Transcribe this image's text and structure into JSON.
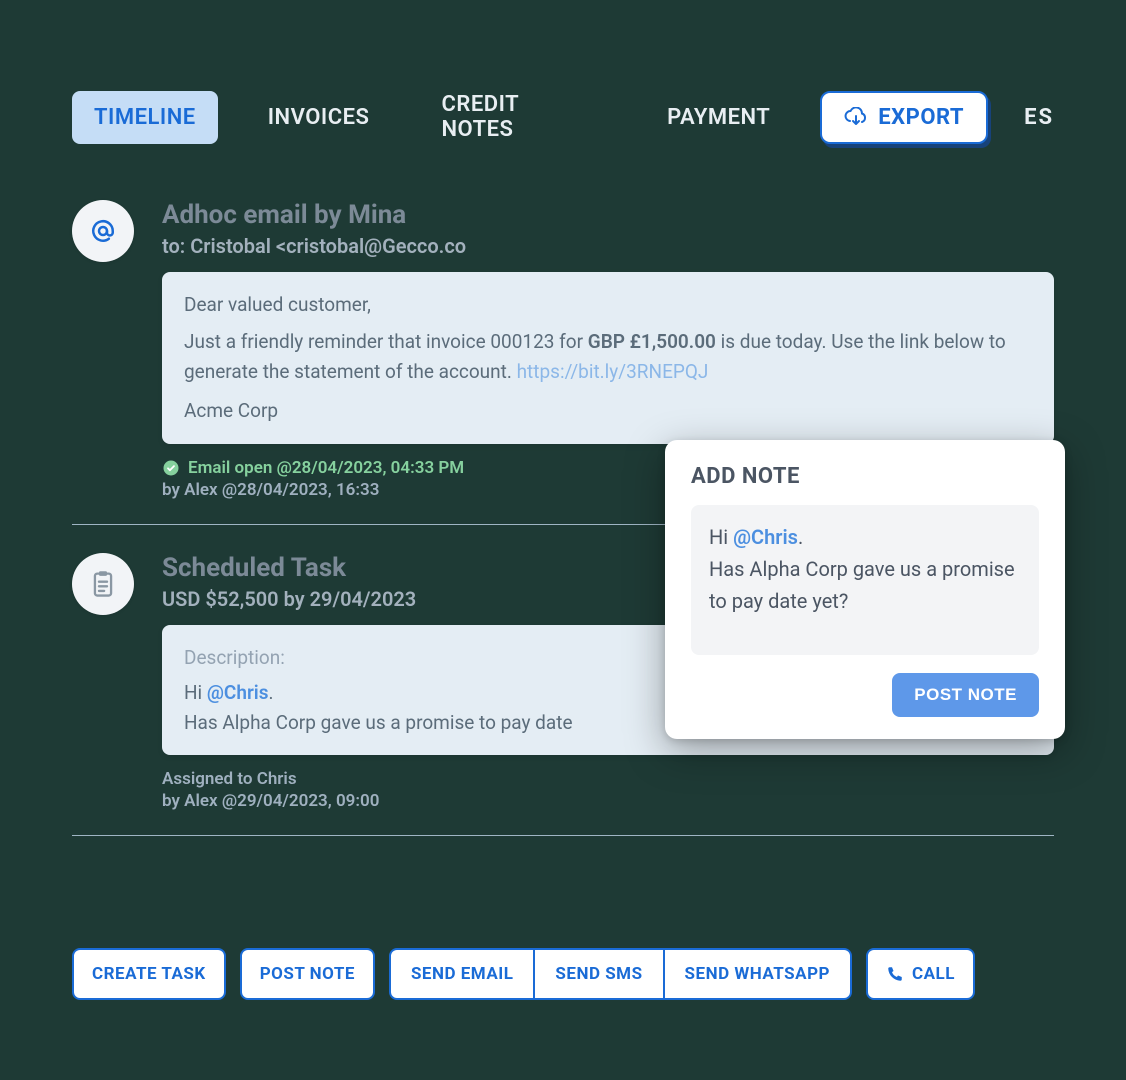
{
  "tabs": {
    "timeline": "TIMELINE",
    "invoices": "INVOICES",
    "credit_notes": "CREDIT NOTES",
    "payment": "PAYMENT",
    "trailing": "ES"
  },
  "export_label": "EXPORT",
  "entries": {
    "email": {
      "title": "Adhoc email by Mina",
      "to_line": "to: Cristobal <cristobal@Gecco.co",
      "body_line1": "Dear valued customer,",
      "body_line2a": "Just a friendly reminder that invoice 000123 for ",
      "amount": "GBP £1,500.00",
      "body_line2b": " is due today. Use the link below to generate the statement of the account. ",
      "link": "https://bit.ly/3RNEPQJ",
      "signoff": "Acme Corp",
      "status": "Email open @28/04/2023, 04:33 PM",
      "by": "by Alex @28/04/2023, 16:33"
    },
    "task": {
      "title": "Scheduled Task",
      "sub": "USD $52,500 by 29/04/2023",
      "desc_label": "Description:",
      "desc_hi": "Hi ",
      "desc_mention": "@Chris",
      "desc_period": ".",
      "desc_line2": "Has Alpha Corp gave us a promise to pay date",
      "assigned": "Assigned to Chris",
      "by": "by Alex @29/04/2023, 09:00"
    }
  },
  "actions": {
    "create_task": "CREATE TASK",
    "post_note": "POST NOTE",
    "send_email": "SEND EMAIL",
    "send_sms": "SEND SMS",
    "send_whatsapp": "SEND WHATSAPP",
    "call": "CALL"
  },
  "popover": {
    "title": "ADD NOTE",
    "hi": "Hi ",
    "mention": "@Chris",
    "period": ".",
    "body": "Has Alpha Corp gave us a promise to pay date yet?",
    "post_label": "POST NOTE"
  }
}
